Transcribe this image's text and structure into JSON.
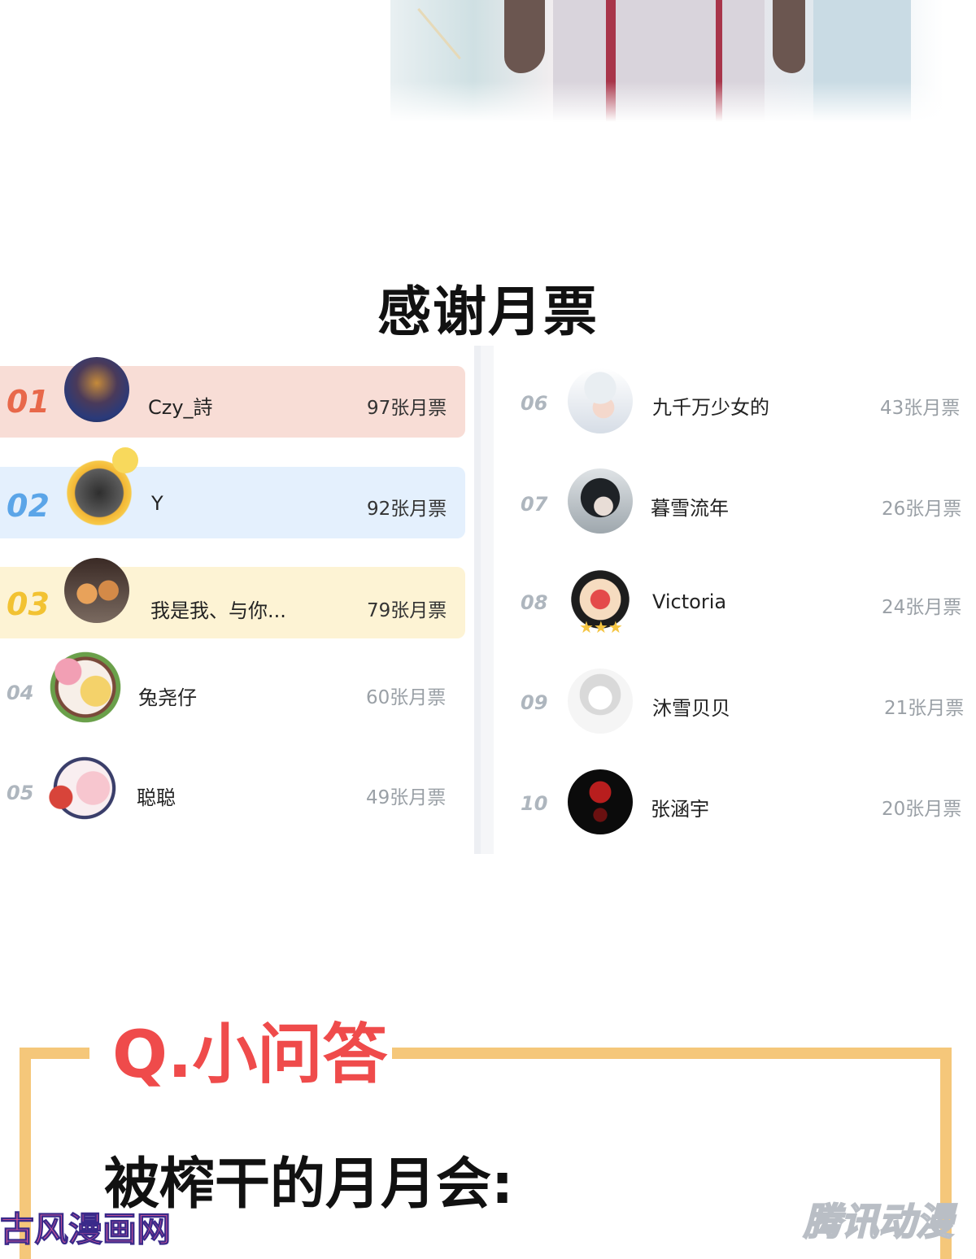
{
  "heading": "感谢月票",
  "left_ranks": [
    {
      "rank": "01",
      "name": "Czy_詩",
      "tickets": "97张月票",
      "rank_color": "#e8684a",
      "bg": "#f8ddd6",
      "avatar": "dinner-photo"
    },
    {
      "rank": "02",
      "name": "Y",
      "tickets": "92张月票",
      "rank_color": "#5ba5e8",
      "bg": "#e4f0fd",
      "avatar": "flower-frame-portrait"
    },
    {
      "rank": "03",
      "name": "我是我、与你...",
      "tickets": "79张月票",
      "rank_color": "#f2c232",
      "bg": "#fdf3d4",
      "avatar": "pomeranian-dogs"
    },
    {
      "rank": "04",
      "name": "兔尧仔",
      "tickets": "60张月票",
      "avatar": "blossom-wreath-anime"
    },
    {
      "rank": "05",
      "name": "聪聪",
      "tickets": "49张月票",
      "avatar": "lucky-charm-anime"
    }
  ],
  "right_ranks": [
    {
      "rank": "06",
      "name": "九千万少女的",
      "tickets": "43张月票",
      "avatar": "anime-girl-cap"
    },
    {
      "rank": "07",
      "name": "暮雪流年",
      "tickets": "26张月票",
      "avatar": "dark-haired-girl"
    },
    {
      "rank": "08",
      "name": "Victoria",
      "tickets": "24张月票",
      "avatar": "penguin-badge"
    },
    {
      "rank": "09",
      "name": "沐雪贝贝",
      "tickets": "21张月票",
      "avatar": "sketch-anime-girl"
    },
    {
      "rank": "10",
      "name": "张涵宇",
      "tickets": "20张月票",
      "avatar": "neon-02-sign"
    }
  ],
  "qa": {
    "title": "Q.小问答",
    "question": "被榨干的月月会:"
  },
  "watermarks": {
    "left": "古风漫画网",
    "right": "腾讯动漫"
  }
}
